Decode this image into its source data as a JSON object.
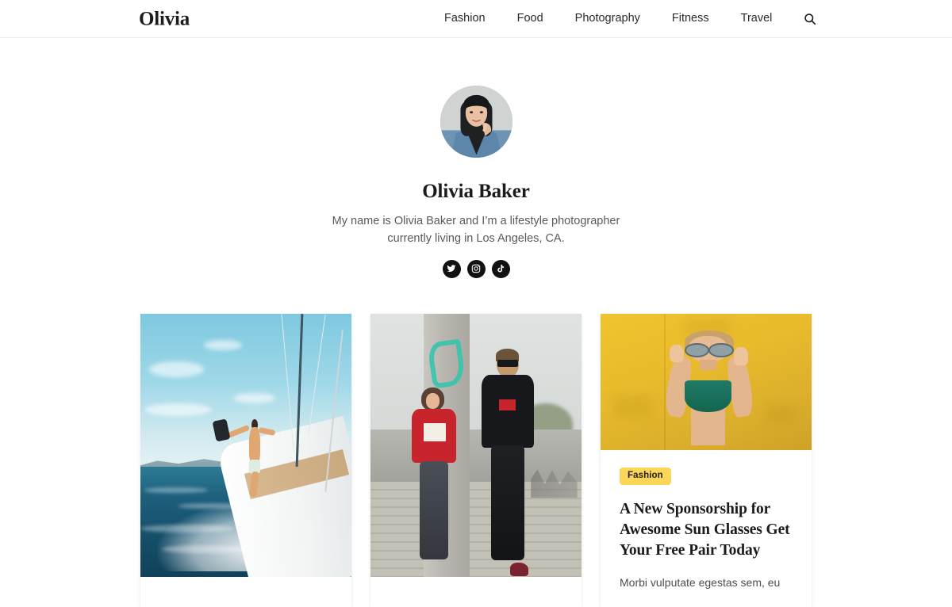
{
  "header": {
    "brand": "Olivia",
    "nav": [
      {
        "label": "Fashion"
      },
      {
        "label": "Food"
      },
      {
        "label": "Photography"
      },
      {
        "label": "Fitness"
      },
      {
        "label": "Travel"
      }
    ],
    "search_icon": "search-icon"
  },
  "profile": {
    "avatar_alt": "Olivia Baker portrait",
    "name": "Olivia Baker",
    "bio_line1": "My name is Olivia Baker and I’m a lifestyle photographer",
    "bio_line2": "currently living in Los Angeles, CA.",
    "socials": [
      {
        "name": "twitter",
        "icon": "twitter-icon"
      },
      {
        "name": "instagram",
        "icon": "instagram-icon"
      },
      {
        "name": "tiktok",
        "icon": "tiktok-icon"
      }
    ]
  },
  "posts": [
    {
      "image_alt": "Man leaning off a sailboat over blue ocean water",
      "category": "",
      "title": "",
      "excerpt": ""
    },
    {
      "image_alt": "Couple in street style outfits leaning on a concrete pillar",
      "category": "",
      "title": "",
      "excerpt": ""
    },
    {
      "image_alt": "Woman with round sunglasses in front of a yellow wall",
      "category": "Fashion",
      "title": "A New Sponsorship for Awesome Sun Glasses Get Your Free Pair Today",
      "excerpt": "Morbi vulputate egestas sem, eu"
    }
  ],
  "colors": {
    "badge_background": "#fcd757",
    "badge_text": "#262017",
    "text_primary": "#1b1b1b",
    "text_secondary": "#5a5a5a",
    "header_border": "#ececec",
    "social_background": "#111111",
    "page_background": "#ffffff"
  }
}
